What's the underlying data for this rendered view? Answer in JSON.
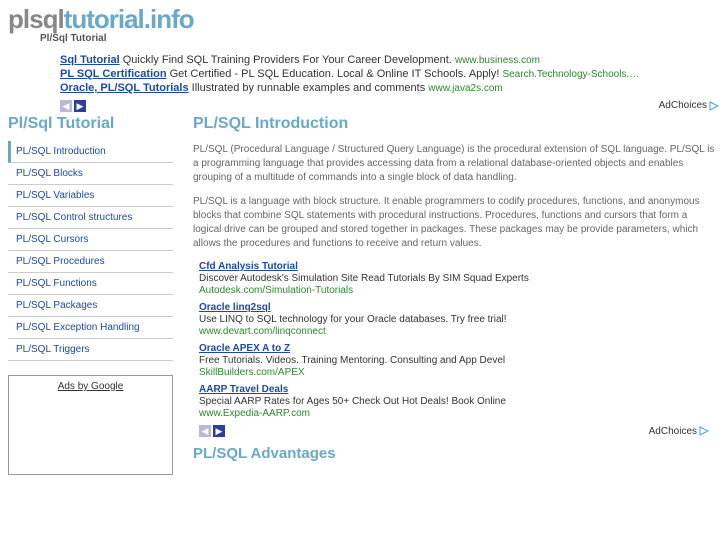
{
  "logo": {
    "part1": "plsql",
    "part2": "tutorial.info"
  },
  "breadcrumb": "Pl/Sql Tutorial",
  "topads": [
    {
      "title": "Sql Tutorial",
      "desc": "Quickly Find SQL Training Providers For Your Career Development.",
      "src": "www.business.com"
    },
    {
      "title": "PL SQL Certification",
      "desc": "Get Certified - PL SQL Education. Local & Online IT Schools. Apply!",
      "src": "Search.Technology-Schools.…"
    },
    {
      "title": "Oracle, PL/SQL Tutorials",
      "desc": "Illustrated by runnable examples and comments",
      "src": "www.java2s.com"
    }
  ],
  "adchoices_label": "AdChoices",
  "sidebar": {
    "heading": "Pl/Sql Tutorial",
    "items": [
      "PL/SQL Introduction",
      "PL/SQL Blocks",
      "PL/SQL Variables",
      "PL/SQL Control structures",
      "PL/SQL Cursors",
      "PL/SQL Procedures",
      "PL/SQL Functions",
      "PL/SQL Packages",
      "PL/SQL Exception Handling",
      "PL/SQL Triggers"
    ],
    "adbox_label": "Ads by Google"
  },
  "content": {
    "title": "PL/SQL Introduction",
    "para1": "PL/SQL (Procedural Language / Structured Query Language) is the procedural extension of SQL language. PL/SQL is a programming language that provides accessing data from a relational database-oriented objects and enables grouping of a multitude of commands into a single block of data handling.",
    "para2": "PL/SQL is a language with block structure. It enable programmers to codify procedures, functions, and anonymous blocks that combine SQL statements with procedural instructions. Procedures, functions and cursors that form a logical drive can be grouped and stored together in packages. These packages may be provide parameters, which allows the procedures and functions to receive and return values.",
    "inlineads": [
      {
        "title": "Cfd Analysis Tutorial",
        "desc": "Discover Autodesk's Simulation Site Read Tutorials By SIM Squad Experts",
        "src": "Autodesk.com/Simulation-Tutorials"
      },
      {
        "title": "Oracle linq2sql",
        "desc": "Use LINQ to SQL technology for your Oracle databases. Try free trial!",
        "src": "www.devart.com/linqconnect"
      },
      {
        "title": "Oracle APEX A to Z",
        "desc": "Free Tutorials. Videos. Training Mentoring. Consulting and App Devel",
        "src": "SkillBuilders.com/APEX"
      },
      {
        "title": "AARP Travel Deals",
        "desc": "Special AARP Rates for Ages 50+ Check Out Hot Deals! Book Online",
        "src": "www.Expedia-AARP.com"
      }
    ],
    "subheading": "PL/SQL Advantages"
  }
}
